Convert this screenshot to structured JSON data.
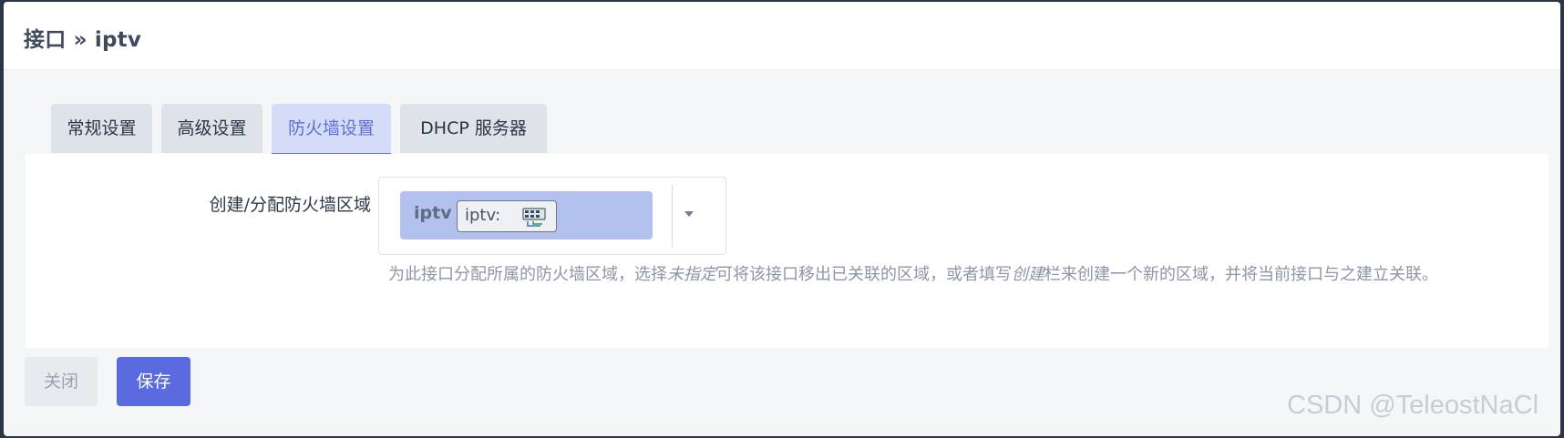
{
  "modal": {
    "title": "接口 » iptv"
  },
  "tabs": [
    {
      "label": "常规设置",
      "active": false
    },
    {
      "label": "高级设置",
      "active": false
    },
    {
      "label": "防火墙设置",
      "active": true
    },
    {
      "label": "DHCP 服务器",
      "active": false
    }
  ],
  "firewall": {
    "field_label": "创建/分配防火墙区域",
    "selected_zone": "iptv",
    "zone_badge": "iptv:",
    "badge_icon": "network-ports-icon",
    "description_before": "为此接口分配所属的防火墙区域，选择",
    "description_unspecified": "未指定",
    "description_middle": "可将该接口移出已关联的区域，或者填写",
    "description_create": "创建",
    "description_after": "栏来创建一个新的区域，并将当前接口与之建立关联。"
  },
  "footer": {
    "close_label": "关闭",
    "save_label": "保存"
  },
  "watermark": "CSDN @TeleostNaCl",
  "colors": {
    "accent": "#5a6be0",
    "chip": "#b3c1ee",
    "tab_active_bg": "#d5dcf7",
    "tab_bg": "#dee3ea"
  }
}
